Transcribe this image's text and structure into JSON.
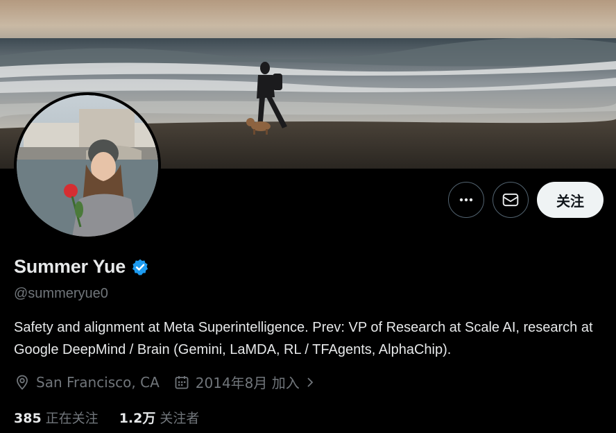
{
  "profile": {
    "display_name": "Summer Yue",
    "handle": "@summeryue0",
    "bio": "Safety and alignment at Meta Superintelligence. Prev: VP of Research at Scale AI, research at Google DeepMind / Brain (Gemini, LaMDA, RL / TFAgents, AlphaChip).",
    "location": "San Francisco, CA",
    "joined": "2014年8月 加入",
    "verified_color": "#1d9bf0"
  },
  "actions": {
    "more_icon": "more-icon",
    "message_icon": "mail-icon",
    "follow_label": "关注"
  },
  "stats": {
    "following_count": "385",
    "following_label": "正在关注",
    "followers_count": "1.2万",
    "followers_label": "关注者"
  },
  "colors": {
    "background": "#000000",
    "text_primary": "#e7e9ea",
    "text_secondary": "#71767b",
    "follow_button_bg": "#eff3f4"
  }
}
